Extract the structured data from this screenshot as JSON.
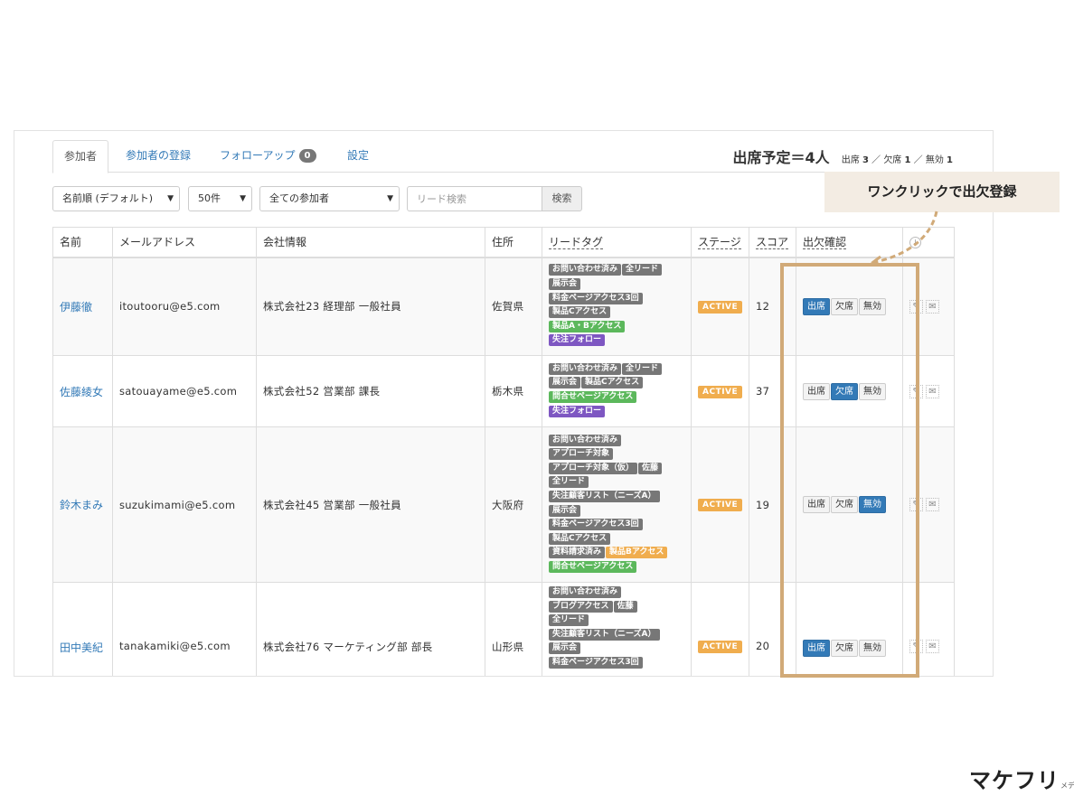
{
  "tabs": [
    {
      "label": "参加者"
    },
    {
      "label": "参加者の登録"
    },
    {
      "label": "フォローアップ",
      "badge": "0"
    },
    {
      "label": "設定"
    }
  ],
  "summary": {
    "title": "出席予定＝4人",
    "present_label": "出席",
    "present_count": "3",
    "sep1": "／",
    "absent_label": "欠席",
    "absent_count": "1",
    "sep2": "／",
    "invalid_label": "無効",
    "invalid_count": "1"
  },
  "filters": {
    "sort": "名前順 (デフォルト)",
    "per_page": "50件",
    "audience": "全ての参加者",
    "search_placeholder": "リード検索",
    "search_button": "検索"
  },
  "columns": [
    "名前",
    "メールアドレス",
    "会社情報",
    "住所",
    "リードタグ",
    "ステージ",
    "スコア",
    "出欠確認"
  ],
  "rows": [
    {
      "name": "伊藤徹",
      "email": "itoutooru@e5.com",
      "company": "株式会社23 経理部 一般社員",
      "address": "佐賀県",
      "stage": "ACTIVE",
      "score": "12",
      "attendance": "出席",
      "tags": [
        [
          {
            "t": "お問い合わせ済み",
            "c": "gray"
          },
          {
            "t": "全リード",
            "c": "gray"
          }
        ],
        [
          {
            "t": "展示会",
            "c": "gray"
          }
        ],
        [
          {
            "t": "料金ページアクセス3回",
            "c": "gray"
          }
        ],
        [
          {
            "t": "製品Cアクセス",
            "c": "gray"
          }
        ],
        [
          {
            "t": "製品A・Bアクセス",
            "c": "green"
          }
        ],
        [
          {
            "t": "失注フォロー",
            "c": "purple"
          }
        ]
      ]
    },
    {
      "name": "佐藤綾女",
      "email": "satouayame@e5.com",
      "company": "株式会社52 営業部 課長",
      "address": "栃木県",
      "stage": "ACTIVE",
      "score": "37",
      "attendance": "欠席",
      "tags": [
        [
          {
            "t": "お問い合わせ済み",
            "c": "gray"
          },
          {
            "t": "全リード",
            "c": "gray"
          }
        ],
        [
          {
            "t": "展示会",
            "c": "gray"
          },
          {
            "t": "製品Cアクセス",
            "c": "gray"
          }
        ],
        [
          {
            "t": "問合せページアクセス",
            "c": "green"
          }
        ],
        [
          {
            "t": "失注フォロー",
            "c": "purple"
          }
        ]
      ]
    },
    {
      "name": "鈴木まみ",
      "email": "suzukimami@e5.com",
      "company": "株式会社45 営業部 一般社員",
      "address": "大阪府",
      "stage": "ACTIVE",
      "score": "19",
      "attendance": "無効",
      "tags": [
        [
          {
            "t": "お問い合わせ済み",
            "c": "gray"
          }
        ],
        [
          {
            "t": "アプローチ対象",
            "c": "gray"
          }
        ],
        [
          {
            "t": "アプローチ対象（仮）",
            "c": "gray"
          },
          {
            "t": "佐藤",
            "c": "gray"
          }
        ],
        [
          {
            "t": "全リード",
            "c": "gray"
          }
        ],
        [
          {
            "t": "失注顧客リスト（ニーズA）",
            "c": "gray"
          }
        ],
        [
          {
            "t": "展示会",
            "c": "gray"
          }
        ],
        [
          {
            "t": "料金ページアクセス3回",
            "c": "gray"
          }
        ],
        [
          {
            "t": "製品Cアクセス",
            "c": "gray"
          }
        ],
        [
          {
            "t": "資料請求済み",
            "c": "gray"
          },
          {
            "t": "製品Bアクセス",
            "c": "orange"
          }
        ],
        [
          {
            "t": "問合せページアクセス",
            "c": "green"
          }
        ]
      ]
    },
    {
      "name": "田中美紀",
      "email": "tanakamiki@e5.com",
      "company": "株式会社76 マーケティング部 部長",
      "address": "山形県",
      "stage": "ACTIVE",
      "score": "20",
      "attendance": "出席",
      "tags": [
        [
          {
            "t": "お問い合わせ済み",
            "c": "gray"
          }
        ],
        [
          {
            "t": "ブログアクセス",
            "c": "gray"
          },
          {
            "t": "佐藤",
            "c": "gray"
          }
        ],
        [
          {
            "t": "全リード",
            "c": "gray"
          }
        ],
        [
          {
            "t": "失注顧客リスト（ニーズA）",
            "c": "gray"
          }
        ],
        [
          {
            "t": "展示会",
            "c": "gray"
          }
        ],
        [
          {
            "t": "料金ページアクセス3回",
            "c": "gray"
          }
        ]
      ]
    }
  ],
  "attendance_options": [
    "出席",
    "欠席",
    "無効"
  ],
  "callout": "ワンクリックで出欠登録",
  "logo": {
    "main": "マケフリ",
    "sub": "メディア"
  },
  "colors": {
    "link": "#337ab7",
    "highlight": "#d1aa78",
    "stage": "#f0ad4e",
    "tag_gray": "#777777",
    "tag_green": "#5cb85c",
    "tag_purple": "#7e57c2"
  }
}
